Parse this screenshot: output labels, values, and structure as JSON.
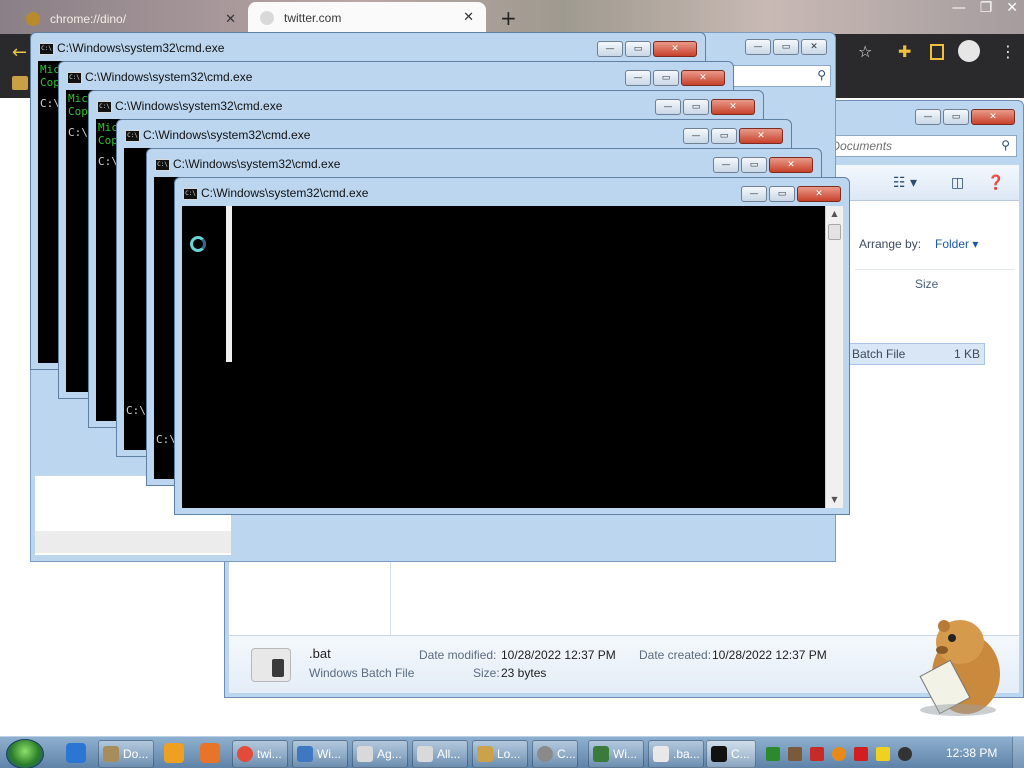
{
  "chrome": {
    "tabs": [
      {
        "label": "chrome://dino/"
      },
      {
        "label": "twitter.com"
      }
    ],
    "new_tab": "+",
    "back": "←",
    "caption": [
      "—",
      "❐",
      "✕"
    ]
  },
  "explorer": {
    "search_placeholder": "Search Documents",
    "arrange_label": "Arrange by:",
    "arrange_value": "Folder ▾",
    "column_size": "Size",
    "file_row_type": "Batch File",
    "file_row_size": "1 KB",
    "details": {
      "name": ".bat",
      "type": "Windows Batch File",
      "modified_label": "Date modified:",
      "modified_value": "10/28/2022 12:37 PM",
      "size_label": "Size:",
      "size_value": "23 bytes",
      "created_label": "Date created:",
      "created_value": "10/28/2022 12:37 PM"
    }
  },
  "cmd_windows": [
    {
      "title": "C:\\Windows\\system32\\cmd.exe",
      "banner": "Mic\nCop",
      "prompt": "C:\\"
    },
    {
      "title": "C:\\Windows\\system32\\cmd.exe",
      "banner": "Mic\nCop",
      "prompt": "C:\\"
    },
    {
      "title": "C:\\Windows\\system32\\cmd.exe",
      "banner": "Mic\nCop",
      "prompt": "C:\\"
    },
    {
      "title": "C:\\Windows\\system32\\cmd.exe",
      "banner": "",
      "prompt": "C:\\"
    },
    {
      "title": "C:\\Windows\\system32\\cmd.exe",
      "banner": "",
      "prompt": "C:\\"
    },
    {
      "title": "C:\\Windows\\system32\\cmd.exe",
      "banner": "",
      "prompt": ""
    }
  ],
  "cmd_buttons": {
    "minimize": "—",
    "maximize": "▭",
    "close": "✕"
  },
  "taskbar": {
    "items": [
      {
        "label": "Do...",
        "color": "#a88d5c"
      },
      {
        "label": "twi...",
        "color": "#e24b3a"
      },
      {
        "label": "Wi...",
        "color": "#3e78c2"
      },
      {
        "label": "Ag...",
        "color": "#d9d9d9"
      },
      {
        "label": "All...",
        "color": "#d9d9d9"
      },
      {
        "label": "Lo...",
        "color": "#c9a24a"
      },
      {
        "label": "C...",
        "color": "#8a8a8a"
      },
      {
        "label": "Wi...",
        "color": "#3a7a3a"
      },
      {
        "label": ".ba...",
        "color": "#e8e8e8"
      },
      {
        "label": "C...",
        "color": "#111111"
      }
    ],
    "clock": "12:38 PM"
  }
}
